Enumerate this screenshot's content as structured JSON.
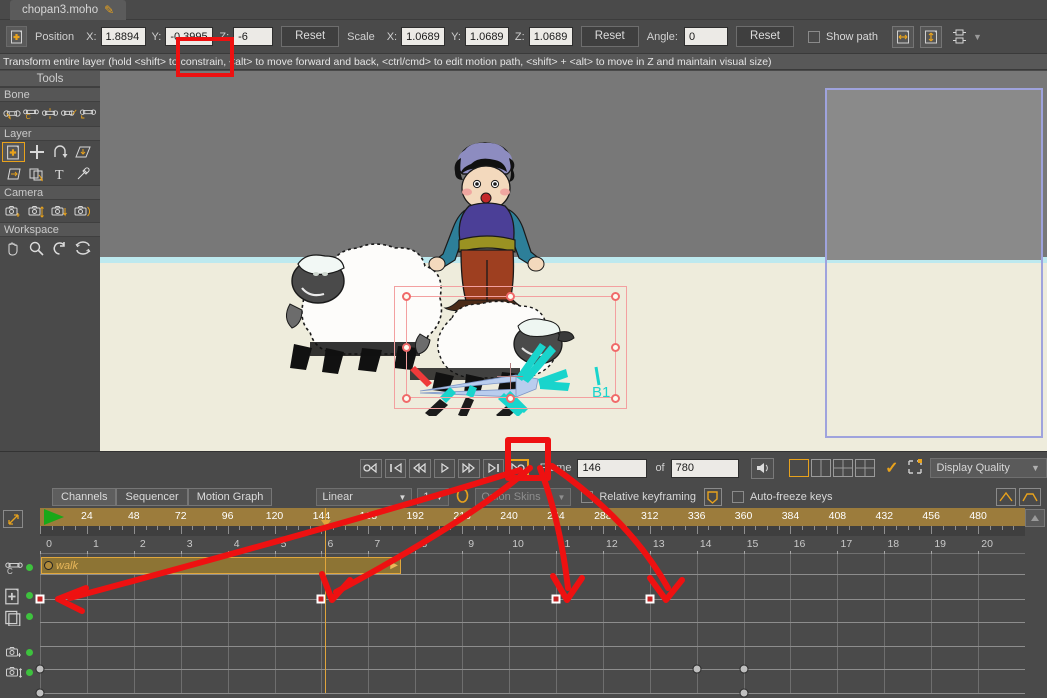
{
  "titlebar": {
    "document_name": "chopan3.moho",
    "modified_icon": "pencil-icon"
  },
  "toolbar": {
    "layer_icon": "layer-transform-icon",
    "position_label": "Position",
    "x_label": "X:",
    "y_label": "Y:",
    "z_label": "Z:",
    "position_x": "1.8894",
    "position_y": "-0.3995",
    "position_z": "-6",
    "reset_position": "Reset",
    "scale_label": "Scale",
    "scale_x": "1.0689",
    "scale_y": "1.0689",
    "scale_z": "1.0689",
    "reset_scale": "Reset",
    "angle_label": "Angle:",
    "angle_value": "0",
    "reset_angle": "Reset",
    "show_path_label": "Show path",
    "flip_h_icon": "flip-horizontal-icon",
    "flip_v_icon": "flip-vertical-icon",
    "more_icon": "transform-more-icon"
  },
  "hint": "Transform entire layer (hold <shift> to constrain, <alt> to move forward and back, <ctrl/cmd> to edit motion path, <shift> + <alt> to move in Z and maintain visual size)",
  "tools": {
    "title": "Tools",
    "groups": [
      {
        "name": "Bone",
        "tools": [
          {
            "label": "Select Bone",
            "icon": "bone-select-icon",
            "selected": false
          },
          {
            "label": "Rotate Bone",
            "icon": "bone-rotate-icon",
            "selected": false
          },
          {
            "label": "Scale Bone",
            "icon": "bone-scale-icon",
            "selected": false
          },
          {
            "label": "Bone Strength",
            "icon": "bone-strength-icon",
            "selected": false
          },
          {
            "label": "Offset Bone",
            "icon": "bone-offset-icon",
            "selected": false
          }
        ]
      },
      {
        "name": "Layer",
        "tools": [
          {
            "label": "Transform Layer",
            "icon": "layer-transform-icon",
            "selected": true
          },
          {
            "label": "Move Layer",
            "icon": "layer-move-icon",
            "selected": false
          },
          {
            "label": "Rotate Layer",
            "icon": "layer-rotate-icon",
            "selected": false
          },
          {
            "label": "Shear Layer",
            "icon": "layer-shear-icon",
            "selected": false
          },
          {
            "label": "Flip Layer",
            "icon": "layer-flip-icon",
            "selected": false
          },
          {
            "label": "Set Origin",
            "icon": "layer-origin-icon",
            "selected": false
          },
          {
            "label": "Text Tool",
            "icon": "text-icon",
            "selected": false
          },
          {
            "label": "Eyedropper",
            "icon": "eyedropper-icon",
            "selected": false
          }
        ]
      },
      {
        "name": "Camera",
        "tools": [
          {
            "label": "Track Camera",
            "icon": "camera-track-icon",
            "selected": false
          },
          {
            "label": "Zoom Camera",
            "icon": "camera-zoom-icon",
            "selected": false
          },
          {
            "label": "Roll Camera",
            "icon": "camera-roll-icon",
            "selected": false
          },
          {
            "label": "Pan/Tilt Camera",
            "icon": "camera-pantilt-icon",
            "selected": false
          }
        ]
      },
      {
        "name": "Workspace",
        "tools": [
          {
            "label": "Pan Workspace",
            "icon": "hand-icon",
            "selected": false
          },
          {
            "label": "Zoom Workspace",
            "icon": "magnifier-icon",
            "selected": false
          },
          {
            "label": "Rotate Workspace",
            "icon": "rotate-icon",
            "selected": false
          },
          {
            "label": "Orbit Workspace",
            "icon": "orbit-icon",
            "selected": false
          }
        ]
      }
    ]
  },
  "canvas": {
    "bone_label": "B1",
    "selected_layer_bounds": "sheep-layer-selection"
  },
  "playback": {
    "buttons": [
      {
        "name": "rewind-to-start",
        "icon": "o-left-triangle"
      },
      {
        "name": "previous-keyframe",
        "icon": "bar-left-triangle"
      },
      {
        "name": "step-back",
        "icon": "double-left-triangle"
      },
      {
        "name": "play",
        "icon": "right-triangle"
      },
      {
        "name": "step-forward",
        "icon": "double-right-triangle"
      },
      {
        "name": "next-keyframe",
        "icon": "right-triangle-bar"
      },
      {
        "name": "loop-play",
        "icon": "right-triangle-o",
        "active": true
      }
    ],
    "frame_label": "Frame",
    "frame_value": "146",
    "of_label": "of",
    "total_frames": "780",
    "audio_icon": "speaker-icon",
    "layout_buttons": [
      "single-view",
      "two-view",
      "three-view",
      "four-view"
    ],
    "selected_layout": "single-view",
    "checkmark_icon": "check-icon",
    "crop_icon": "crop-icon",
    "display_quality": "Display Quality",
    "dropdown_icon": "chevron-down-icon"
  },
  "channels": {
    "tabs": [
      "Channels",
      "Sequencer",
      "Motion Graph"
    ],
    "selected_tab": "Channels",
    "interpolation": "Linear",
    "interp_count": "1",
    "onion_icon": "onion-skin-icon",
    "onion_skins": "Onion Skins",
    "relative_keyframing": "Relative keyframing",
    "shield_icon": "shield-icon",
    "auto_freeze_keys": "Auto-freeze keys",
    "ease_in_icon": "ease-in-icon",
    "ease_out_icon": "ease-flat-icon"
  },
  "timeline": {
    "ruler_ticks": [
      "0",
      "24",
      "48",
      "72",
      "96",
      "120",
      "144",
      "168",
      "192",
      "216",
      "240",
      "264",
      "288",
      "312",
      "336",
      "360",
      "384",
      "408",
      "432",
      "456",
      "480"
    ],
    "sub_ticks": [
      "0",
      "1",
      "2",
      "3",
      "4",
      "5",
      "6",
      "7",
      "8",
      "9",
      "10",
      "11",
      "12",
      "13",
      "14",
      "15",
      "16",
      "17",
      "18",
      "19",
      "20"
    ],
    "playhead_frame": 146,
    "motion_track_label": "walk",
    "channel_rows": [
      {
        "name": "bone-channel",
        "icon": "bone-rotate-icon",
        "enabled": true,
        "keys": [
          0
        ]
      },
      {
        "name": "layer-translation-channel",
        "icon": "layer-translate-icon",
        "enabled": true,
        "keys": [
          0,
          144,
          264,
          312
        ]
      },
      {
        "name": "layer-scale-channel",
        "icon": "layer-scale-icon",
        "enabled": true,
        "keys": []
      },
      {
        "name": "camera-track-channel",
        "icon": "camera-track-icon",
        "enabled": true,
        "keys": [
          0,
          336,
          360
        ]
      },
      {
        "name": "camera-zoom-channel",
        "icon": "camera-zoom-icon",
        "enabled": true,
        "keys": [
          0,
          360
        ]
      }
    ],
    "scroll_up_icon": "scroll-up-icon",
    "expand_icon": "expand-arrows-icon"
  },
  "annotations": {
    "color": "#ee1111",
    "highlight_field": "position_y",
    "highlight_button": "loop-play"
  }
}
